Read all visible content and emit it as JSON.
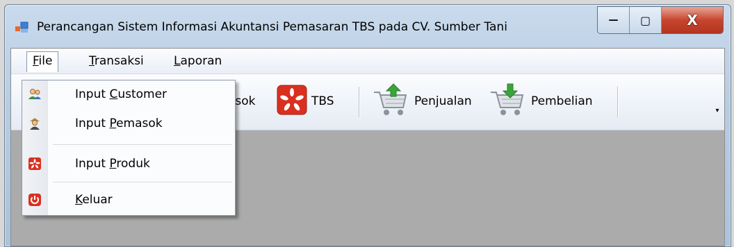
{
  "window": {
    "title": "Perancangan Sistem Informasi Akuntansi Pemasaran TBS pada CV. Sumber Tani",
    "minimize_glyph": "—",
    "restore_glyph": "▢",
    "close_glyph": "X"
  },
  "menubar": {
    "items": [
      {
        "label_pre": "",
        "mnemonic": "F",
        "label_post": "ile",
        "open": true
      },
      {
        "label_pre": "",
        "mnemonic": "T",
        "label_post": "ransaksi",
        "open": false
      },
      {
        "label_pre": "",
        "mnemonic": "L",
        "label_post": "aporan",
        "open": false
      }
    ]
  },
  "toolbar": {
    "items": [
      {
        "label": "asok",
        "icon": "supplier-icon"
      },
      {
        "label": "TBS",
        "icon": "tbs-icon"
      },
      {
        "label": "Penjualan",
        "icon": "cart-sale-icon"
      },
      {
        "label": "Pembelian",
        "icon": "cart-purchase-icon"
      }
    ],
    "overflow_glyph": "▾"
  },
  "file_menu": {
    "items": [
      {
        "pre": "Input ",
        "mnemonic": "C",
        "post": "ustomer",
        "icon": "customer-icon"
      },
      {
        "pre": "Input ",
        "mnemonic": "P",
        "post": "emasok",
        "icon": "supplier-icon"
      },
      {
        "pre": "Input ",
        "mnemonic": "P",
        "post": "roduk",
        "icon": "product-icon"
      },
      {
        "pre": "",
        "mnemonic": "K",
        "post": "eluar",
        "icon": "power-icon"
      }
    ]
  },
  "colors": {
    "accent_red": "#d9301f",
    "cart_green": "#3aa53a",
    "mdi_background": "#ababab"
  }
}
